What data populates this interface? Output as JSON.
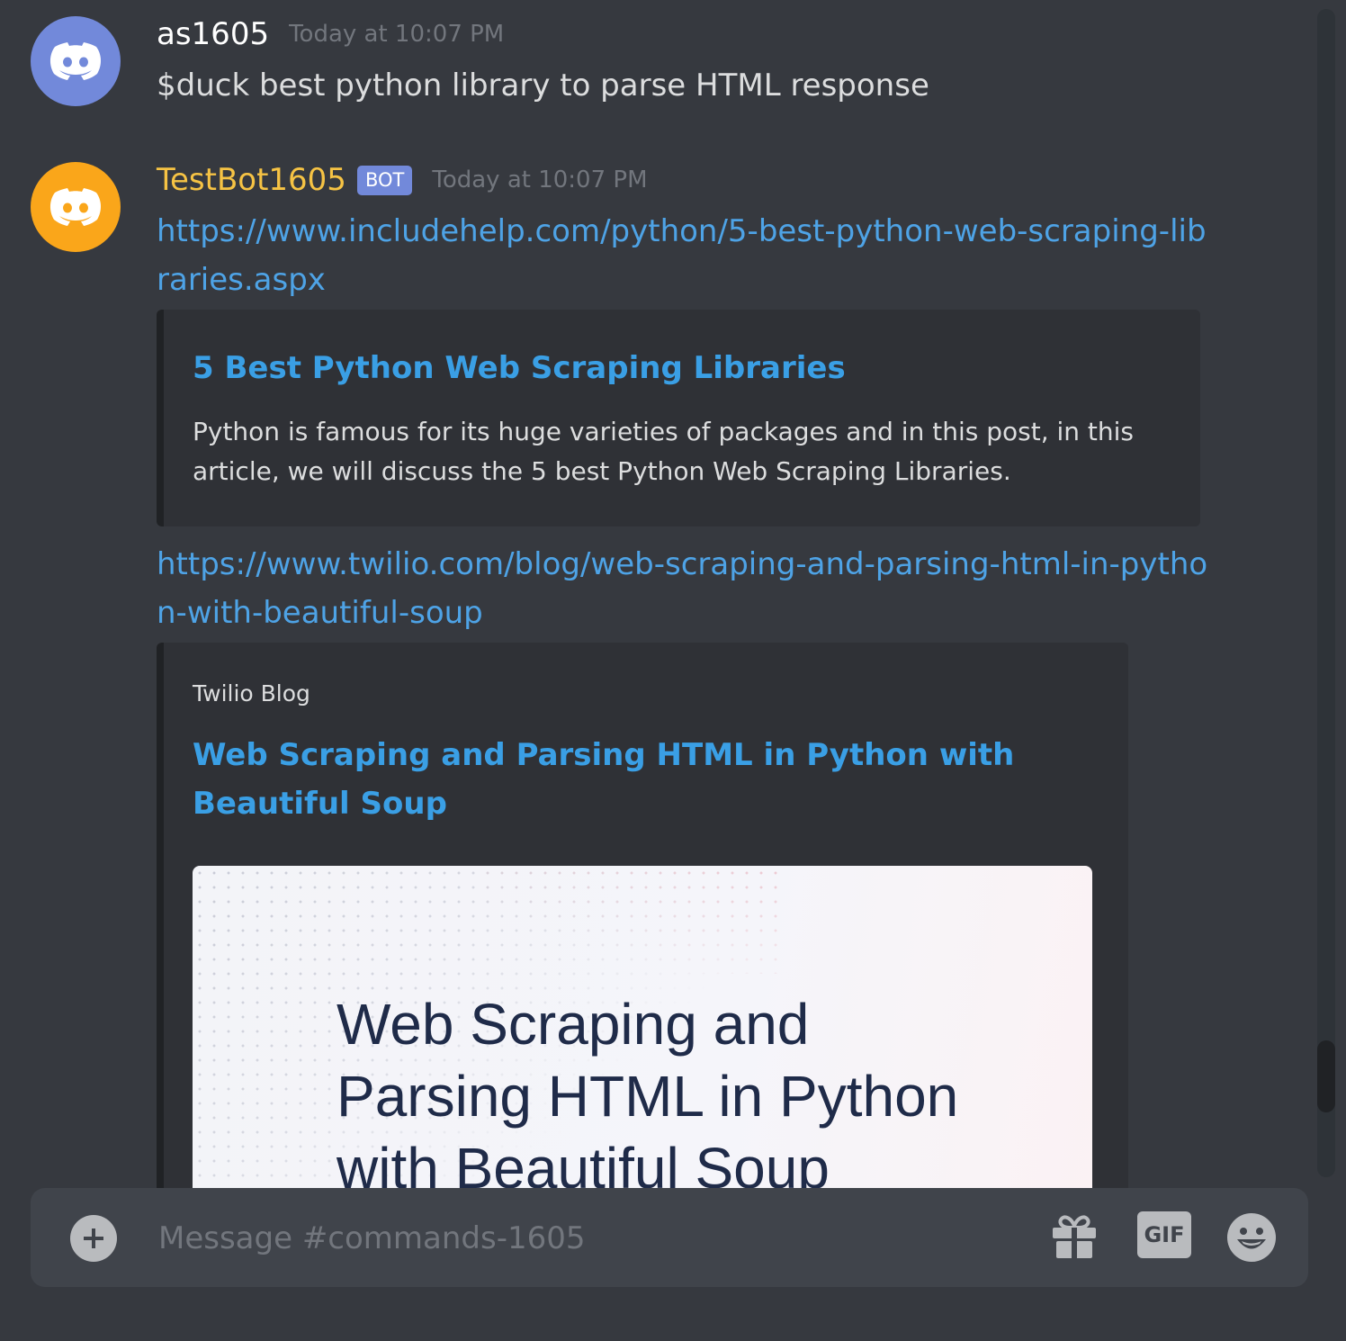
{
  "messages": [
    {
      "username": "as1605",
      "username_color": "#ffffff",
      "avatar_color": "#7289da",
      "timestamp": "Today at 10:07 PM",
      "text": "$duck best python library to parse HTML response"
    },
    {
      "username": "TestBot1605",
      "username_color": "#f6c344",
      "avatar_color": "#faa61a",
      "bot_tag": "BOT",
      "timestamp": "Today at 10:07 PM",
      "links": [
        {
          "url": "https://www.includehelp.com/python/5-best-python-web-scraping-libraries.aspx",
          "embed": {
            "title": "5 Best Python Web Scraping Libraries",
            "description": "Python is famous for its huge varieties of packages and in this post, in this article, we will discuss the 5 best Python Web Scraping Libraries."
          }
        },
        {
          "url": "https://www.twilio.com/blog/web-scraping-and-parsing-html-in-python-with-beautiful-soup",
          "embed": {
            "provider": "Twilio Blog",
            "title": "Web Scraping and Parsing HTML in Python with Beautiful Soup",
            "image_text": "Web Scraping and\nParsing HTML in Python\nwith Beautiful Soup"
          }
        }
      ]
    }
  ],
  "composer": {
    "placeholder": "Message #commands-1605",
    "gif_label": "GIF",
    "icons": [
      "add-icon",
      "gift-icon",
      "gif-icon",
      "emoji-icon"
    ]
  }
}
